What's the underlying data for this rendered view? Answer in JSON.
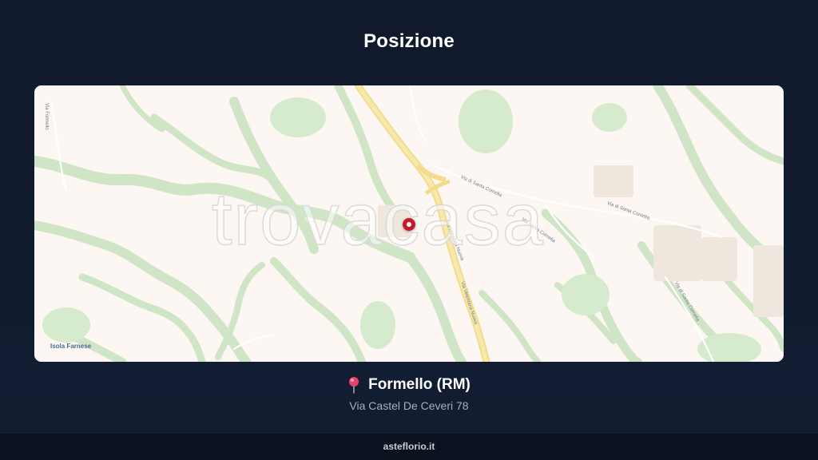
{
  "section": {
    "title": "Posizione"
  },
  "map": {
    "watermark": "trovacasa",
    "place_label": "Isola Farnese",
    "street_labels": [
      "Via Formello",
      "Via di Santa Cornelia",
      "Via Vetuslata Nuova",
      "Via Santa Cornelia",
      "Via di Santa Cornelia",
      "Via Veientana Nuova",
      "Via di Santa Cornelia"
    ],
    "marker_color": "#c9182b"
  },
  "location": {
    "icon": "map-pin-icon",
    "name": "Formello (RM)",
    "address": "Via Castel De Ceveri 78"
  },
  "footer": {
    "text": "asteflorio.it"
  }
}
